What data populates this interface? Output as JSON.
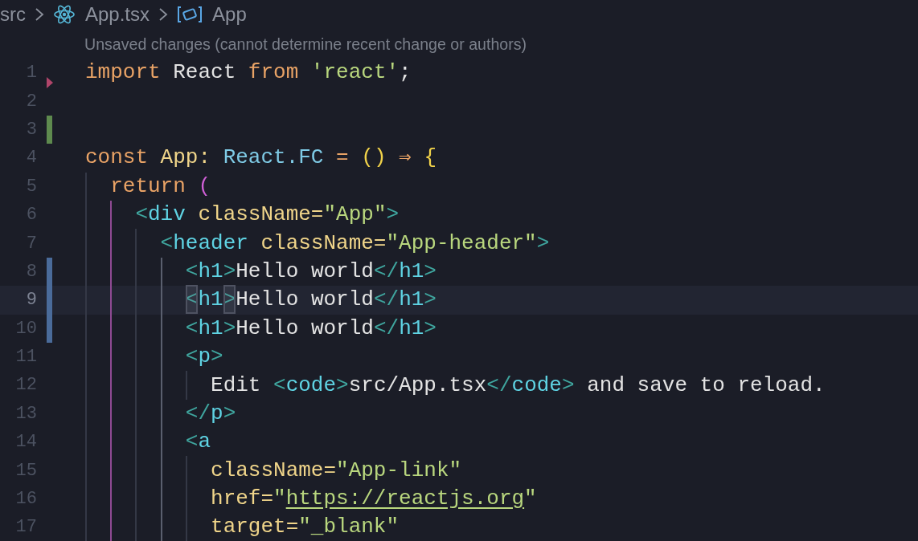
{
  "breadcrumb": [
    {
      "label": "src",
      "kind": "folder"
    },
    {
      "label": "App.tsx",
      "kind": "file"
    },
    {
      "label": "App",
      "kind": "symbol"
    }
  ],
  "codelens": "Unsaved changes (cannot determine recent change or authors)",
  "lines": [
    {
      "number": "1",
      "kind": "plain",
      "current": false,
      "tokens": [
        {
          "text": "import",
          "kind": "kw"
        },
        {
          "text": " React ",
          "kind": "id"
        },
        {
          "text": "from",
          "kind": "kw"
        },
        {
          "text": " 'react'",
          "kind": "str"
        },
        {
          "text": ";",
          "kind": "id"
        }
      ]
    },
    {
      "number": "2",
      "kind": "deleted",
      "current": false
    },
    {
      "number": "3",
      "kind": "added",
      "current": false
    },
    {
      "number": "4",
      "kind": "plain",
      "current": false,
      "tokens": [
        {
          "text": "const",
          "kind": "kw"
        },
        {
          "text": " App: ",
          "kind": "attr"
        },
        {
          "text": "React.FC ",
          "kind": "type"
        },
        {
          "text": "= ",
          "kind": "op"
        },
        {
          "text": "() ",
          "kind": "paren"
        },
        {
          "text": "⇒ ",
          "kind": "op"
        },
        {
          "text": "{",
          "kind": "paren"
        }
      ]
    },
    {
      "number": "5",
      "kind": "plain",
      "current": false,
      "tokens": [
        {
          "text": "  return ",
          "kind": "kw"
        },
        {
          "text": "(",
          "kind": "purple"
        }
      ]
    },
    {
      "number": "6",
      "kind": "plain",
      "current": false,
      "tokens": [
        {
          "text": "    <",
          "kind": "tagp"
        },
        {
          "text": "div",
          "kind": "tag"
        },
        {
          "text": " className=",
          "kind": "attr"
        },
        {
          "text": "\"App\"",
          "kind": "str"
        },
        {
          "text": ">",
          "kind": "tagp"
        }
      ]
    },
    {
      "number": "7",
      "kind": "plain",
      "current": false,
      "tokens": [
        {
          "text": "      <",
          "kind": "tagp"
        },
        {
          "text": "header",
          "kind": "tag"
        },
        {
          "text": " className=",
          "kind": "attr"
        },
        {
          "text": "\"App-header\"",
          "kind": "str"
        },
        {
          "text": ">",
          "kind": "tagp"
        }
      ]
    },
    {
      "number": "8",
      "kind": "modified",
      "current": false,
      "tokens": [
        {
          "text": "        <",
          "kind": "tagp"
        },
        {
          "text": "h1",
          "kind": "tag"
        },
        {
          "text": ">",
          "kind": "tagp"
        },
        {
          "text": "Hello world",
          "kind": "id"
        },
        {
          "text": "</",
          "kind": "tagp"
        },
        {
          "text": "h1",
          "kind": "tag"
        },
        {
          "text": ">",
          "kind": "tagp"
        }
      ]
    },
    {
      "number": "9",
      "kind": "modified",
      "current": true,
      "tokens": [
        {
          "text": "        <",
          "kind": "tagp",
          "matched": true
        },
        {
          "text": "h1",
          "kind": "tag"
        },
        {
          "text": ">",
          "kind": "tagp",
          "matched": true
        },
        {
          "text": "Hello world",
          "kind": "id"
        },
        {
          "text": "</",
          "kind": "tagp"
        },
        {
          "text": "h1",
          "kind": "tag"
        },
        {
          "text": ">",
          "kind": "tagp"
        }
      ]
    },
    {
      "number": "10",
      "kind": "modified",
      "current": false,
      "tokens": [
        {
          "text": "        <",
          "kind": "tagp"
        },
        {
          "text": "h1",
          "kind": "tag"
        },
        {
          "text": ">",
          "kind": "tagp"
        },
        {
          "text": "Hello world",
          "kind": "id"
        },
        {
          "text": "</",
          "kind": "tagp"
        },
        {
          "text": "h1",
          "kind": "tag"
        },
        {
          "text": ">",
          "kind": "tagp"
        }
      ]
    },
    {
      "number": "11",
      "kind": "plain",
      "current": false,
      "tokens": [
        {
          "text": "        <",
          "kind": "tagp"
        },
        {
          "text": "p",
          "kind": "tag"
        },
        {
          "text": ">",
          "kind": "tagp"
        }
      ]
    },
    {
      "number": "12",
      "kind": "plain",
      "current": false,
      "tokens": [
        {
          "text": "          Edit ",
          "kind": "id"
        },
        {
          "text": "<",
          "kind": "tagp"
        },
        {
          "text": "code",
          "kind": "tag"
        },
        {
          "text": ">",
          "kind": "tagp"
        },
        {
          "text": "src/App.tsx",
          "kind": "id"
        },
        {
          "text": "</",
          "kind": "tagp"
        },
        {
          "text": "code",
          "kind": "tag"
        },
        {
          "text": ">",
          "kind": "tagp"
        },
        {
          "text": " and save to reload.",
          "kind": "id"
        }
      ]
    },
    {
      "number": "13",
      "kind": "plain",
      "current": false,
      "tokens": [
        {
          "text": "        </",
          "kind": "tagp"
        },
        {
          "text": "p",
          "kind": "tag"
        },
        {
          "text": ">",
          "kind": "tagp"
        }
      ]
    },
    {
      "number": "14",
      "kind": "plain",
      "current": false,
      "tokens": [
        {
          "text": "        <",
          "kind": "tagp"
        },
        {
          "text": "a",
          "kind": "tag"
        }
      ]
    },
    {
      "number": "15",
      "kind": "plain",
      "current": false,
      "tokens": [
        {
          "text": "          className=",
          "kind": "attr"
        },
        {
          "text": "\"App-link\"",
          "kind": "str"
        }
      ]
    },
    {
      "number": "16",
      "kind": "plain",
      "current": false,
      "tokens": [
        {
          "text": "          href=",
          "kind": "attr"
        },
        {
          "text": "\"",
          "kind": "str"
        },
        {
          "text": "https://reactjs.org",
          "kind": "link"
        },
        {
          "text": "\"",
          "kind": "str"
        }
      ]
    },
    {
      "number": "17",
      "kind": "plain",
      "current": false,
      "tokens": [
        {
          "text": "          target=",
          "kind": "attr"
        },
        {
          "text": "\"_blank\"",
          "kind": "str"
        }
      ]
    }
  ]
}
